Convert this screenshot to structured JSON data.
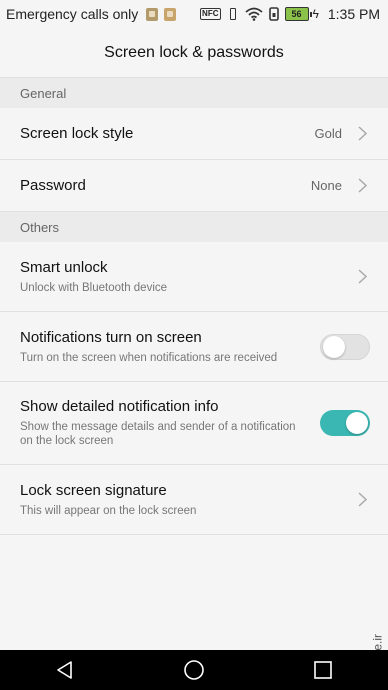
{
  "status_bar": {
    "carrier": "Emergency calls only",
    "nfc": "NFC",
    "battery_level": "56",
    "time": "1:35 PM"
  },
  "title": "Screen lock & passwords",
  "sections": {
    "general": "General",
    "others": "Others"
  },
  "rows": {
    "screen_lock_style": {
      "label": "Screen lock style",
      "value": "Gold"
    },
    "password": {
      "label": "Password",
      "value": "None"
    },
    "smart_unlock": {
      "label": "Smart unlock",
      "sub": "Unlock with Bluetooth device"
    },
    "notifications_screen": {
      "label": "Notifications turn on screen",
      "sub": "Turn on the screen when notifications are received",
      "enabled": false
    },
    "detailed_info": {
      "label": "Show detailed notification info",
      "sub_line1": "Show the message details and sender of a notification",
      "sub_line2": "on the lock screen",
      "enabled": true
    },
    "lock_signature": {
      "label": "Lock screen signature",
      "sub": "This will appear on the lock screen"
    }
  },
  "watermark": "mobile.ir",
  "colors": {
    "toggle_on": "#3ab7b2",
    "background": "#f5f5f5",
    "section": "#ebebeb"
  },
  "nav": {
    "back": "back-icon",
    "home": "home-icon",
    "recents": "recents-icon"
  }
}
